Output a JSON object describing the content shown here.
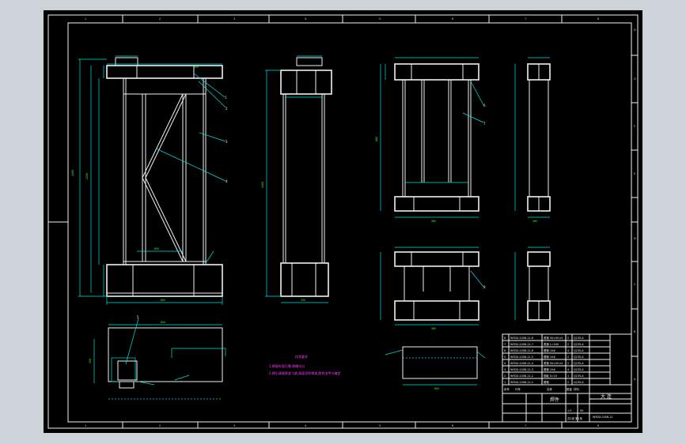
{
  "border": {
    "zones_top": [
      "1",
      "2",
      "3",
      "4",
      "5",
      "6",
      "7",
      "8"
    ],
    "zones_side": [
      "A",
      "B",
      "C",
      "D",
      "E",
      "F",
      "G",
      "H"
    ]
  },
  "notes": {
    "heading": "技术要求",
    "line1": "1.焊接牢固可靠,焊缝均匀",
    "line2": "2.焊后清理焊渣飞溅,表面涂防锈漆,颜色由甲方确定"
  },
  "title_block": {
    "part_name": "焊件",
    "company": "大 连",
    "drawing_no": "WYDX-2008-12",
    "scale": "1:5",
    "sheet": "共1张 第1张",
    "weight": "95",
    "bom_rows": [
      [
        "8",
        "WYDX-2008-12-8",
        "角钢 50×50×5",
        "2",
        "Q235-A"
      ],
      [
        "7",
        "WYDX-2008-12-7",
        "角钢 L=540",
        "2",
        "Q235-A"
      ],
      [
        "6",
        "WYDX-2008-12-6",
        "槽钢 10#",
        "4",
        "Q235-A"
      ],
      [
        "5",
        "WYDX-2008-12-5",
        "槽钢 10#",
        "2",
        "Q235-A"
      ],
      [
        "4",
        "WYDX-2008-12-4",
        "角钢 50×50×5",
        "2",
        "Q235-A"
      ],
      [
        "3",
        "WYDX-2008-12-3",
        "槽钢 10#",
        "4",
        "Q235-A"
      ],
      [
        "2",
        "WYDX-2008-12-2",
        "钢板 δ=10",
        "1",
        "Q235-A"
      ],
      [
        "1",
        "WYDX-2008-12-1",
        "槽钢",
        "2",
        "Q235-A"
      ]
    ],
    "header": [
      "序号",
      "代号",
      "名称",
      "数量",
      "材料"
    ]
  },
  "balloons": [
    "1",
    "2",
    "3",
    "4",
    "5",
    "6",
    "7",
    "8",
    "9"
  ],
  "dims": {
    "front_total_h": "1480",
    "front_inner_h": "1200",
    "front_w": "800",
    "front_top": "500",
    "side_h": "1400",
    "side_w": "250",
    "plan_w": "800",
    "plan_d": "420",
    "r_front_h": "860",
    "r_front_w": "580",
    "r_bottom_w": "580",
    "r_side_w": "160",
    "bot_w": "600"
  }
}
